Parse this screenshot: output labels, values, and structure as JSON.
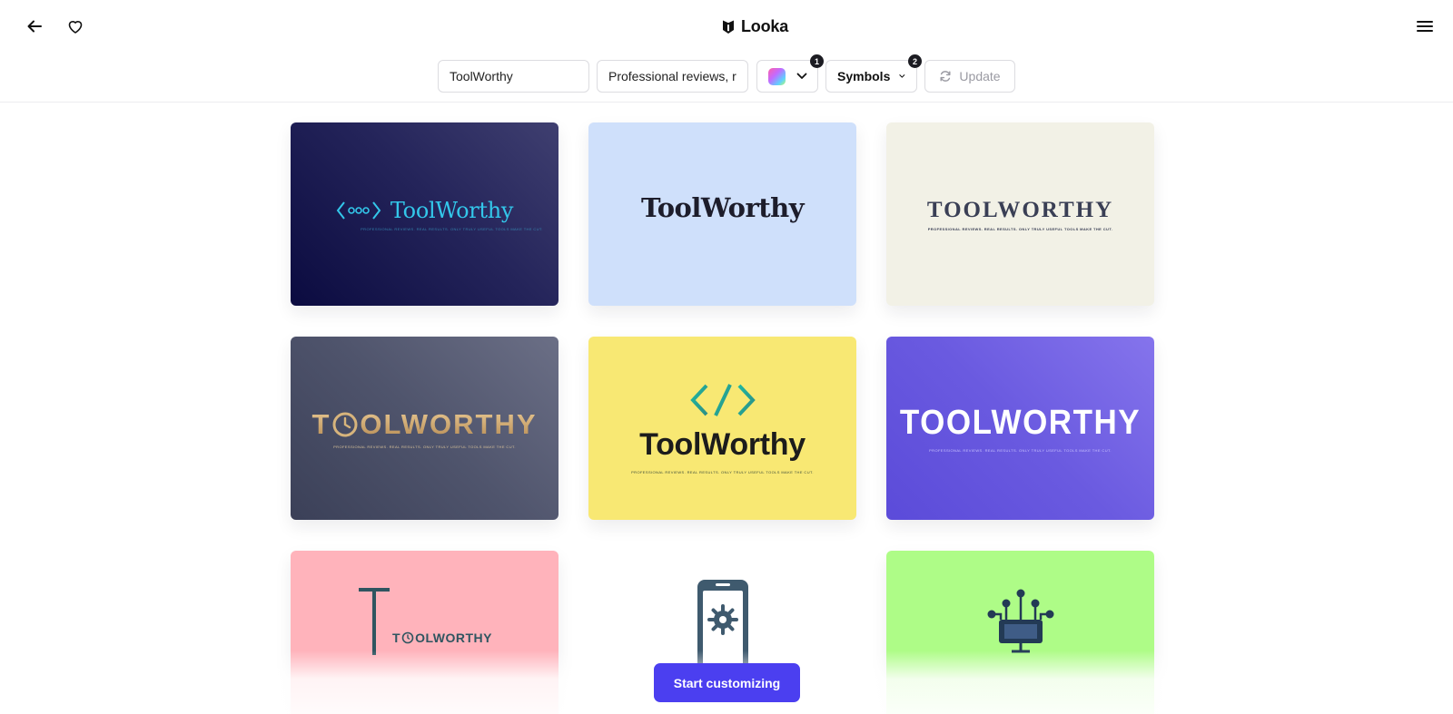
{
  "header": {
    "brand_name": "Looka",
    "back_icon": "arrow-left-icon",
    "favorite_icon": "heart-icon",
    "menu_icon": "hamburger-menu-icon"
  },
  "toolbar": {
    "company_name_value": "ToolWorthy",
    "description_value": "Professional reviews, re",
    "color_filter_badge": "1",
    "symbols_label": "Symbols",
    "symbols_badge": "2",
    "update_label": "Update"
  },
  "logos": [
    {
      "name": "ToolWorthy",
      "tagline": "Professional reviews. Real results. Only truly useful tools make the cut.",
      "background": "#0b0b40",
      "accent": "#33c7ea",
      "symbol": "code-dots-icon"
    },
    {
      "name": "ToolWorthy",
      "background": "#cfe0fb",
      "accent": "#1d1d2b"
    },
    {
      "name": "TOOLWORTHY",
      "tagline": "Professional reviews. Real results. Only truly useful tools make the cut.",
      "background": "#f2f1e6",
      "accent": "#3a3f55"
    },
    {
      "name_prefix": "T",
      "name_suffix": "OLWORTHY",
      "tagline": "Professional reviews. Real results. Only truly useful tools make the cut.",
      "background": "#4f546c",
      "accent": "#c7a06a",
      "symbol": "clock-icon"
    },
    {
      "name": "ToolWorthy",
      "tagline": "Professional reviews. Real results. Only truly useful tools make the cut.",
      "background": "#f8e873",
      "accent": "#1c1c1c",
      "symbol": "code-brackets-icon"
    },
    {
      "name": "TOOLWORTHY",
      "tagline": "Professional reviews. Real results. Only truly useful tools make the cut.",
      "background": "#6a5ae0",
      "accent": "#ffffff"
    },
    {
      "name_prefix": "T",
      "name_suffix": "OLWORTHY",
      "background": "#ffb3bb",
      "accent": "#2f5560",
      "symbol": "gear-circle-icon"
    },
    {
      "background": "#ffffff",
      "accent": "#3f5a6e",
      "symbol": "phone-gear-icon"
    },
    {
      "background": "#aefc87",
      "accent": "#233a55",
      "symbol": "monitor-network-icon"
    }
  ],
  "cta": {
    "label": "Start customizing",
    "color": "#4b3ff0"
  }
}
